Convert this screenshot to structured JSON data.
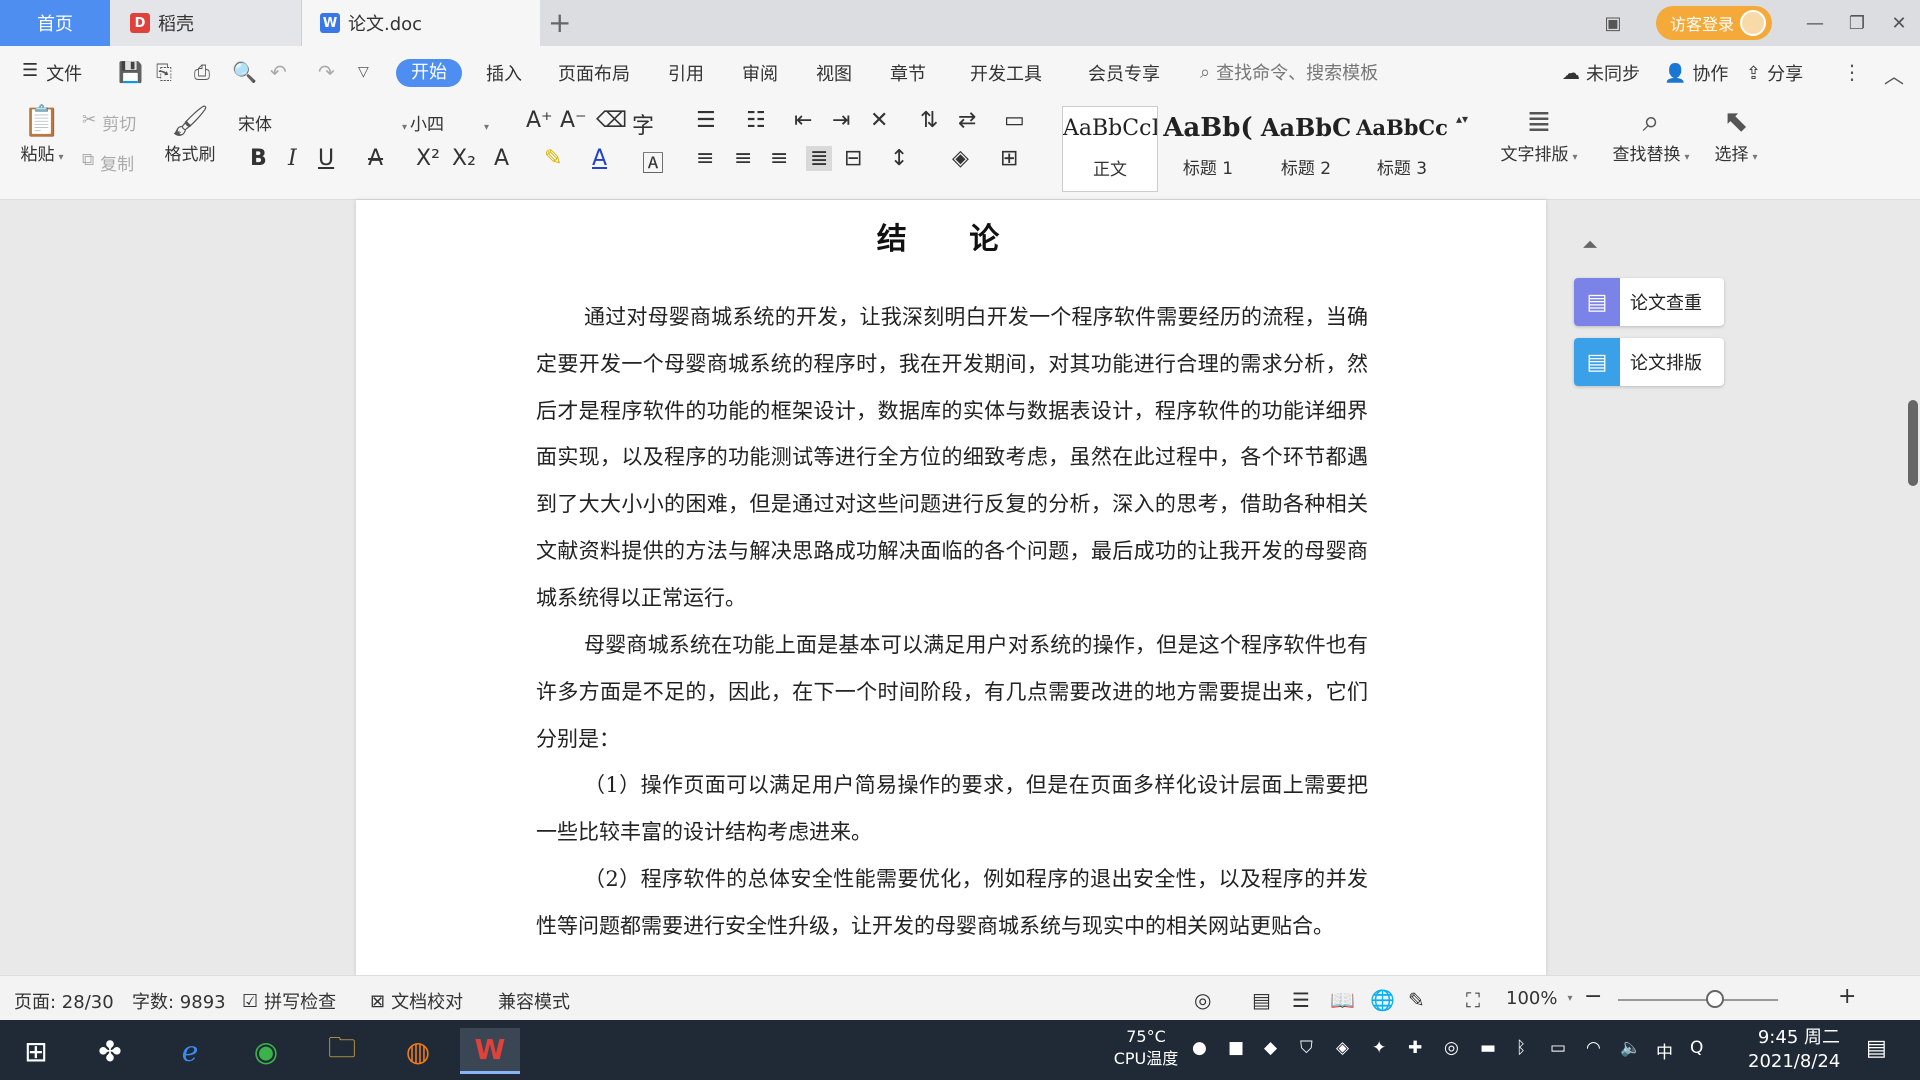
{
  "tabs": {
    "home": "首页",
    "daoke": "稻壳",
    "doc": "论文.doc",
    "new_tab": "+"
  },
  "titlebar": {
    "visitor_login": "访客登录"
  },
  "menu": {
    "file": "文件",
    "start": "开始",
    "insert": "插入",
    "layout": "页面布局",
    "reference": "引用",
    "review": "审阅",
    "view": "视图",
    "chapter": "章节",
    "devtools": "开发工具",
    "vip": "会员专享",
    "search_placeholder": "查找命令、搜索模板",
    "unsync": "未同步",
    "collab": "协作",
    "share": "分享"
  },
  "ribbon": {
    "paste": "粘贴",
    "cut": "剪切",
    "copy": "复制",
    "format_painter": "格式刷",
    "font_name": "宋体",
    "font_size": "小四",
    "styles": [
      {
        "sample": "AaBbCcI",
        "name": "正文"
      },
      {
        "sample": "AaBb(",
        "name": "标题 1"
      },
      {
        "sample": "AaBbC",
        "name": "标题 2"
      },
      {
        "sample": "AaBbCc",
        "name": "标题 3"
      }
    ],
    "text_layout": "文字排版",
    "find_replace": "查找替换",
    "select": "选择"
  },
  "document": {
    "title": "结 论",
    "paragraphs": [
      "通过对母婴商城系统的开发，让我深刻明白开发一个程序软件需要经历的流程，当确定要开发一个母婴商城系统的程序时，我在开发期间，对其功能进行合理的需求分析，然后才是程序软件的功能的框架设计，数据库的实体与数据表设计，程序软件的功能详细界面实现，以及程序的功能测试等进行全方位的细致考虑，虽然在此过程中，各个环节都遇到了大大小小的困难，但是通过对这些问题进行反复的分析，深入的思考，借助各种相关文献资料提供的方法与解决思路成功解决面临的各个问题，最后成功的让我开发的母婴商城系统得以正常运行。",
      "母婴商城系统在功能上面是基本可以满足用户对系统的操作，但是这个程序软件也有许多方面是不足的，因此，在下一个时间阶段，有几点需要改进的地方需要提出来，它们分别是：",
      "（1）操作页面可以满足用户简易操作的要求，但是在页面多样化设计层面上需要把一些比较丰富的设计结构考虑进来。",
      "（2）程序软件的总体安全性能需要优化，例如程序的退出安全性，以及程序的并发性等问题都需要进行安全性升级，让开发的母婴商城系统与现实中的相关网站更贴合。"
    ]
  },
  "side_panel": {
    "check": "论文查重",
    "format": "论文排版"
  },
  "status": {
    "page": "页面: 28/30",
    "words": "字数: 9893",
    "spell": "拼写检查",
    "proof": "文档校对",
    "compat": "兼容模式",
    "zoom": "100%",
    "zoom_level": 0.5
  },
  "taskbar": {
    "cpu_temp": "75°C",
    "cpu_label": "CPU温度",
    "ime": "中",
    "time": "9:45 周二",
    "date": "2021/8/24"
  }
}
